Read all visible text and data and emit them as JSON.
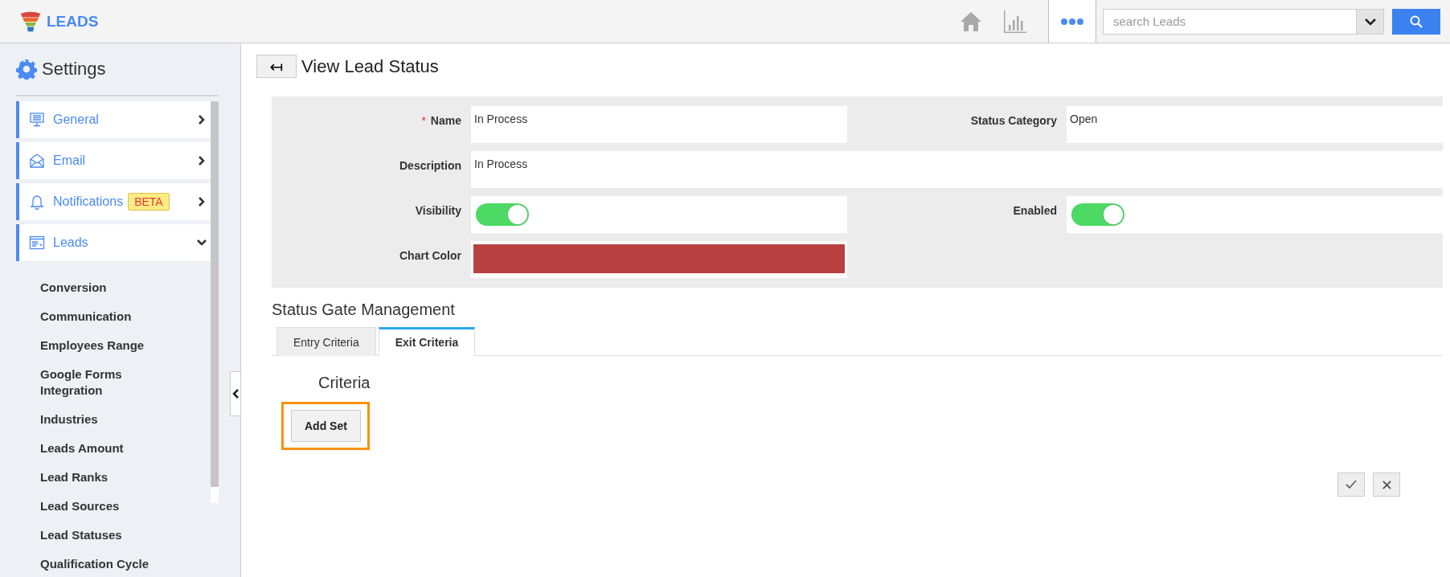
{
  "app": {
    "title": "LEADS"
  },
  "search": {
    "placeholder": "search Leads"
  },
  "sidebar": {
    "title": "Settings",
    "items": [
      {
        "label": "General",
        "expanded": false
      },
      {
        "label": "Email",
        "expanded": false
      },
      {
        "label": "Notifications",
        "badge": "BETA",
        "expanded": false
      },
      {
        "label": "Leads",
        "expanded": true
      }
    ],
    "subitems": [
      "Conversion",
      "Communication",
      "Employees Range",
      "Google Forms Integration",
      "Industries",
      "Leads Amount",
      "Lead Ranks",
      "Lead Sources",
      "Lead Statuses",
      "Qualification Cycle"
    ]
  },
  "page": {
    "back": "↤",
    "title": "View Lead Status"
  },
  "form": {
    "name": {
      "label": "Name",
      "required_mark": "*",
      "value": "In Process"
    },
    "status_category": {
      "label": "Status Category",
      "value": "Open"
    },
    "description": {
      "label": "Description",
      "value": "In Process"
    },
    "visibility": {
      "label": "Visibility",
      "on": true
    },
    "enabled": {
      "label": "Enabled",
      "on": true
    },
    "chart_color": {
      "label": "Chart Color",
      "color": "#b94040"
    }
  },
  "gate": {
    "title": "Status Gate Management",
    "tabs": [
      {
        "label": "Entry Criteria",
        "selected": false
      },
      {
        "label": "Exit Criteria",
        "selected": true
      }
    ],
    "criteria_title": "Criteria",
    "add_set": "Add Set"
  }
}
